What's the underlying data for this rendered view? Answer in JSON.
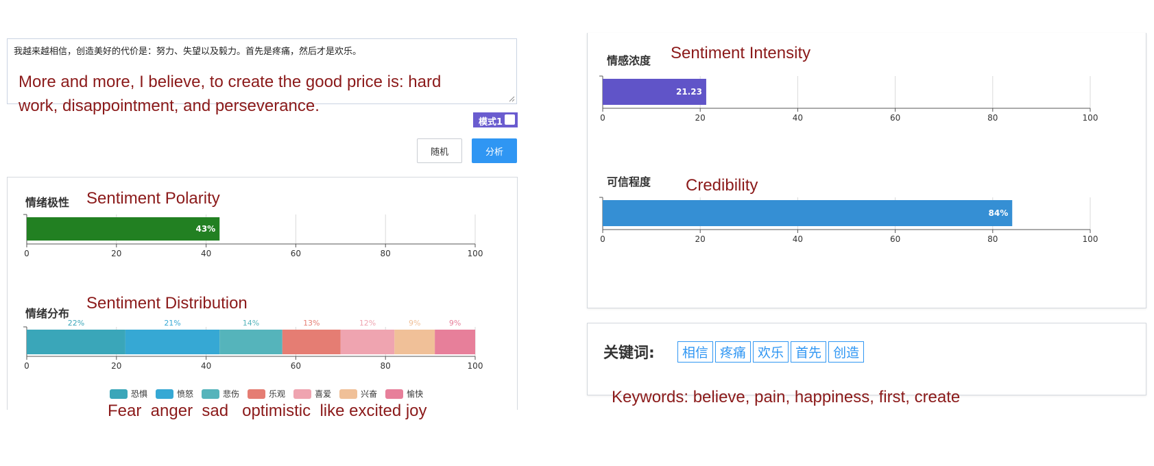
{
  "input": {
    "text": "我越来越相信，创造美好的代价是：努力、失望以及毅力。首先是疼痛，然后才是欢乐。",
    "translation_line1": "More and more, I believe, to create the good price is: hard",
    "translation_line2": "work, disappointment, and perseverance."
  },
  "mode": {
    "label": "模式1"
  },
  "buttons": {
    "random": "随机",
    "analyze": "分析"
  },
  "polarity": {
    "title": "情绪极性",
    "translation": "Sentiment Polarity",
    "value_label": "43%"
  },
  "distribution": {
    "title": "情绪分布",
    "translation": "Sentiment Distribution",
    "legend_translation": "Fear  anger  sad   optimistic  like excited joy"
  },
  "intensity": {
    "title": "情感浓度",
    "translation": "Sentiment Intensity",
    "value_label": "21.23"
  },
  "credibility": {
    "title": "可信程度",
    "translation": "Credibility",
    "value_label": "84%"
  },
  "keywords": {
    "label": "关键词:",
    "items": [
      "相信",
      "疼痛",
      "欢乐",
      "首先",
      "创造"
    ],
    "translation": "Keywords: believe, pain, happiness, first, create"
  },
  "colors": {
    "polarity_bar": "#228022",
    "intensity_bar": "#6054c8",
    "credibility_bar": "#358fd4",
    "accent": "#2f96f3",
    "translation_text": "#8b1a1a"
  },
  "chart_data": [
    {
      "type": "bar",
      "orientation": "horizontal",
      "title": "情绪极性",
      "values": [
        43
      ],
      "data_labels": [
        "43%"
      ],
      "xlim": [
        0,
        100
      ],
      "xticks": [
        "0",
        "20",
        "40",
        "60",
        "80",
        "100"
      ],
      "grid": true
    },
    {
      "type": "bar",
      "orientation": "horizontal",
      "stacked": true,
      "title": "情绪分布",
      "xlim": [
        0,
        100
      ],
      "xticks": [
        "0",
        "20",
        "40",
        "60",
        "80",
        "100"
      ],
      "grid": true,
      "legend": "bottom",
      "series": [
        {
          "name": "恐惧",
          "values": [
            22
          ],
          "label": "22%",
          "color": "#3aa6b9"
        },
        {
          "name": "愤怒",
          "values": [
            21
          ],
          "label": "21%",
          "color": "#36a8d4"
        },
        {
          "name": "悲伤",
          "values": [
            14
          ],
          "label": "14%",
          "color": "#55b4bb"
        },
        {
          "name": "乐观",
          "values": [
            13
          ],
          "label": "13%",
          "color": "#e57d73"
        },
        {
          "name": "喜爱",
          "values": [
            12
          ],
          "label": "12%",
          "color": "#efa4b0"
        },
        {
          "name": "兴奋",
          "values": [
            9
          ],
          "label": "9%",
          "color": "#f0c098"
        },
        {
          "name": "愉快",
          "values": [
            9
          ],
          "label": "9%",
          "color": "#e77f9a"
        }
      ]
    },
    {
      "type": "bar",
      "orientation": "horizontal",
      "title": "情感浓度",
      "values": [
        21.23
      ],
      "data_labels": [
        "21.23"
      ],
      "xlim": [
        0,
        100
      ],
      "xticks": [
        "0",
        "20",
        "40",
        "60",
        "80",
        "100"
      ],
      "grid": true
    },
    {
      "type": "bar",
      "orientation": "horizontal",
      "title": "可信程度",
      "values": [
        84
      ],
      "data_labels": [
        "84%"
      ],
      "xlim": [
        0,
        100
      ],
      "xticks": [
        "0",
        "20",
        "40",
        "60",
        "80",
        "100"
      ],
      "grid": true
    }
  ]
}
